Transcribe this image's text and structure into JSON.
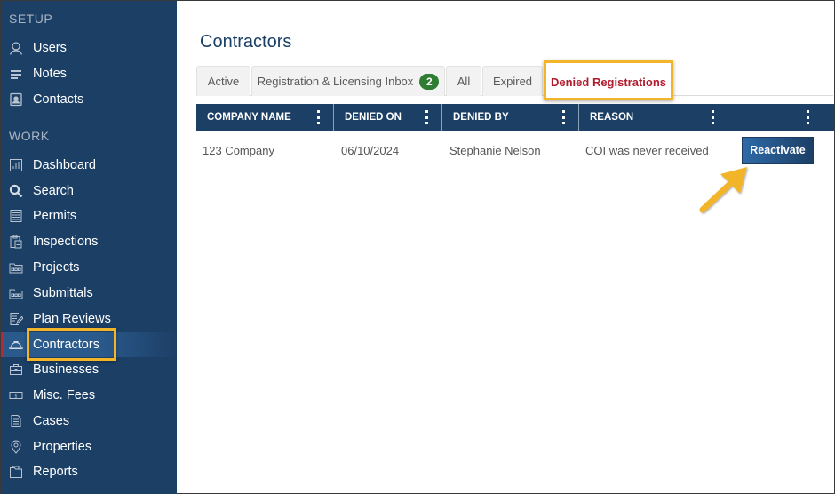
{
  "sidebar": {
    "sections": [
      {
        "title": "SETUP",
        "items": [
          {
            "label": "Users",
            "icon": "user-icon"
          },
          {
            "label": "Notes",
            "icon": "notes-icon"
          },
          {
            "label": "Contacts",
            "icon": "contacts-icon"
          }
        ]
      },
      {
        "title": "WORK",
        "items": [
          {
            "label": "Dashboard",
            "icon": "dashboard-icon"
          },
          {
            "label": "Search",
            "icon": "search-icon"
          },
          {
            "label": "Permits",
            "icon": "permits-icon"
          },
          {
            "label": "Inspections",
            "icon": "inspections-icon"
          },
          {
            "label": "Projects",
            "icon": "projects-icon"
          },
          {
            "label": "Submittals",
            "icon": "submittals-icon"
          },
          {
            "label": "Plan Reviews",
            "icon": "plan-reviews-icon"
          },
          {
            "label": "Contractors",
            "icon": "hard-hat-icon",
            "active": true
          },
          {
            "label": "Businesses",
            "icon": "briefcase-icon"
          },
          {
            "label": "Misc. Fees",
            "icon": "money-icon"
          },
          {
            "label": "Cases",
            "icon": "cases-icon"
          },
          {
            "label": "Properties",
            "icon": "map-pin-icon"
          },
          {
            "label": "Reports",
            "icon": "folder-icon"
          }
        ]
      }
    ]
  },
  "main": {
    "title": "Contractors",
    "tabs": [
      {
        "label": "Active"
      },
      {
        "label": "Registration & Licensing Inbox",
        "badge": "2"
      },
      {
        "label": "All"
      },
      {
        "label": "Expired"
      },
      {
        "label": "Denied Registrations",
        "active": true
      }
    ],
    "grid": {
      "columns": [
        "COMPANY NAME",
        "DENIED ON",
        "DENIED BY",
        "REASON",
        ""
      ],
      "rows": [
        {
          "company_name": "123 Company",
          "denied_on": "06/10/2024",
          "denied_by": "Stephanie Nelson",
          "reason": "COI was never received",
          "action_label": "Reactivate"
        }
      ]
    }
  },
  "colors": {
    "sidebar_bg": "#1c3f66",
    "header_bg": "#1c3f66",
    "active_tab_text": "#b01c2e",
    "badge_bg": "#2e7d32",
    "highlight": "#f2b52a"
  }
}
